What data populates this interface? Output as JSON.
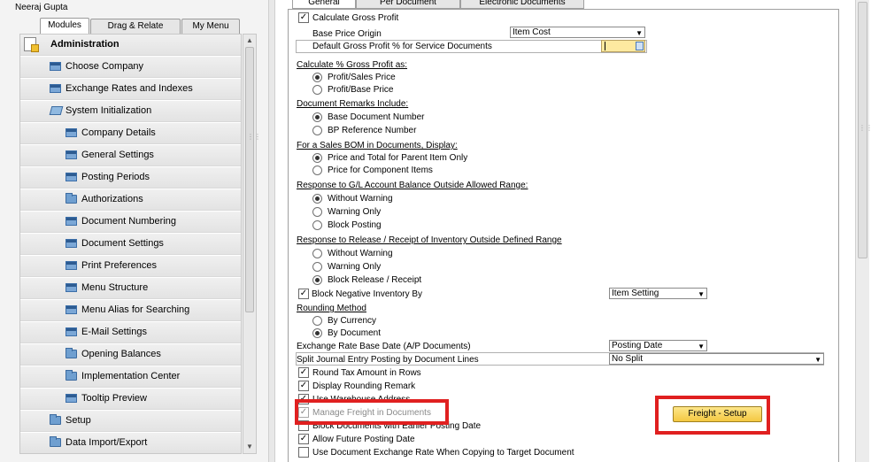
{
  "user_name": "Neeraj Gupta",
  "left_tabs": [
    "Modules",
    "Drag & Relate",
    "My Menu"
  ],
  "tree_items": [
    {
      "label": "Administration",
      "icon": "admin-icon"
    },
    {
      "label": "Choose Company",
      "icon": "window-icon"
    },
    {
      "label": "Exchange Rates and Indexes",
      "icon": "window-icon"
    },
    {
      "label": "System Initialization",
      "icon": "folder-open-icon"
    },
    {
      "label": "Company Details",
      "icon": "window-icon"
    },
    {
      "label": "General Settings",
      "icon": "window-icon"
    },
    {
      "label": "Posting Periods",
      "icon": "window-icon"
    },
    {
      "label": "Authorizations",
      "icon": "folder-icon"
    },
    {
      "label": "Document Numbering",
      "icon": "window-icon"
    },
    {
      "label": "Document Settings",
      "icon": "window-icon"
    },
    {
      "label": "Print Preferences",
      "icon": "window-icon"
    },
    {
      "label": "Menu Structure",
      "icon": "window-icon"
    },
    {
      "label": "Menu Alias for Searching",
      "icon": "window-icon"
    },
    {
      "label": "E-Mail Settings",
      "icon": "window-icon"
    },
    {
      "label": "Opening Balances",
      "icon": "folder-icon"
    },
    {
      "label": "Implementation Center",
      "icon": "folder-icon"
    },
    {
      "label": "Tooltip Preview",
      "icon": "window-icon"
    },
    {
      "label": "Setup",
      "icon": "folder-icon"
    },
    {
      "label": "Data Import/Export",
      "icon": "folder-icon"
    }
  ],
  "doc_tabs": [
    "General",
    "Per Document",
    "Electronic Documents"
  ],
  "form": {
    "calc_gross_profit": "Calculate Gross Profit",
    "base_price_origin_label": "Base Price Origin",
    "base_price_origin_value": "Item Cost",
    "default_gp_label": "Default Gross Profit % for Service Documents",
    "default_gp_value": "",
    "calc_pct_header": "Calculate % Gross Profit as:",
    "calc_pct_options": [
      "Profit/Sales Price",
      "Profit/Base Price"
    ],
    "remarks_header": "Document Remarks Include:",
    "remarks_options": [
      "Base Document Number",
      "BP Reference Number"
    ],
    "bom_header": "For a Sales BOM in Documents, Display:",
    "bom_options": [
      "Price and Total for Parent Item Only",
      "Price for Component Items"
    ],
    "gl_header": "Response to G/L Account Balance Outside Allowed Range:",
    "gl_options": [
      "Without Warning",
      "Warning Only",
      "Block Posting"
    ],
    "inv_header": "Response to Release / Receipt of Inventory Outside Defined Range",
    "inv_options": [
      "Without Warning",
      "Warning Only",
      "Block Release / Receipt"
    ],
    "block_neg_label": "Block Negative Inventory By",
    "block_neg_value": "Item Setting",
    "rounding_header": "Rounding Method",
    "rounding_options": [
      "By Currency",
      "By Document"
    ],
    "exch_label": "Exchange Rate Base Date (A/P Documents)",
    "exch_value": "Posting Date",
    "split_label": "Split Journal Entry Posting by Document Lines",
    "split_value": "No Split",
    "checkboxes": [
      {
        "label": "Round Tax Amount in Rows",
        "checked": true,
        "disabled": false
      },
      {
        "label": "Display Rounding Remark",
        "checked": true,
        "disabled": false
      },
      {
        "label": "Use Warehouse Address",
        "checked": true,
        "disabled": false
      },
      {
        "label": "Manage Freight in Documents",
        "checked": true,
        "disabled": true
      },
      {
        "label": "Block Documents with Earlier Posting Date",
        "checked": false,
        "disabled": false
      },
      {
        "label": "Allow Future Posting Date",
        "checked": true,
        "disabled": false
      },
      {
        "label": "Use Document Exchange Rate When Copying to Target Document",
        "checked": false,
        "disabled": false
      }
    ],
    "freight_setup_label": "Freight - Setup"
  },
  "colors": {
    "highlight_red": "#e02020",
    "button_yellow": "#f4c842",
    "field_yellow": "#fde9a0"
  }
}
